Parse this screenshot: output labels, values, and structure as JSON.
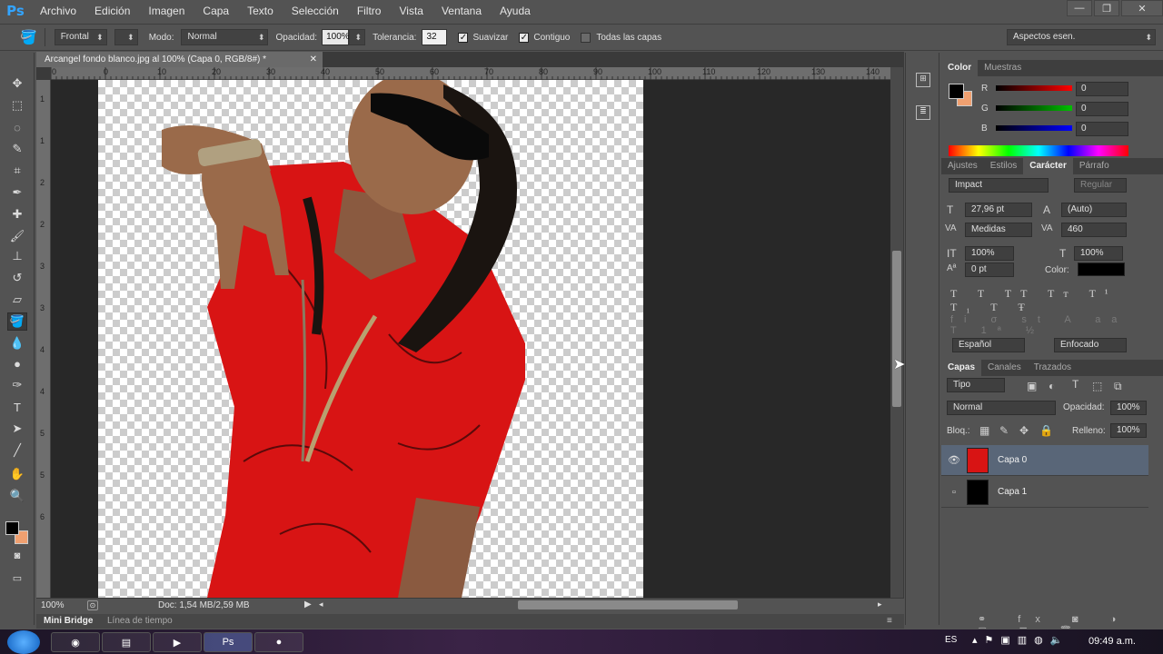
{
  "app": {
    "logo": "Ps",
    "title_controls": [
      "—",
      "❐",
      "✕"
    ]
  },
  "menu": [
    "Archivo",
    "Edición",
    "Imagen",
    "Capa",
    "Texto",
    "Selección",
    "Filtro",
    "Vista",
    "Ventana",
    "Ayuda"
  ],
  "options": {
    "fill_source": "Frontal",
    "mode_label": "Modo:",
    "mode_value": "Normal",
    "opacity_label": "Opacidad:",
    "opacity_value": "100%",
    "tolerance_label": "Tolerancia:",
    "tolerance_value": "32",
    "antialias_label": "Suavizar",
    "contiguous_label": "Contiguo",
    "all_layers_label": "Todas las capas",
    "workspace": "Aspectos esen."
  },
  "document": {
    "tab_title": "Arcangel fondo blanco.jpg al 100% (Capa 0, RGB/8#) *",
    "ruler_h": [
      "0",
      "0",
      "10",
      "20",
      "30",
      "40",
      "50",
      "60",
      "70",
      "80",
      "90",
      "100",
      "110",
      "120",
      "130",
      "140"
    ],
    "ruler_v": [
      "1",
      "1",
      "2",
      "2",
      "3",
      "3",
      "4",
      "4",
      "5",
      "5",
      "6"
    ],
    "zoom": "100%",
    "doc_size": "Doc: 1,54 MB/2,59 MB"
  },
  "bottom_tabs": [
    "Mini Bridge",
    "Línea de tiempo"
  ],
  "color_panel": {
    "tabs": [
      "Color",
      "Muestras"
    ],
    "fg_color": "#000000",
    "bg_color": "#f0a070",
    "r_label": "R",
    "r_value": "0",
    "g_label": "G",
    "g_value": "0",
    "b_label": "B",
    "b_value": "0"
  },
  "character_panel": {
    "tabs": [
      "Ajustes",
      "Estilos",
      "Carácter",
      "Párrafo"
    ],
    "font_family": "Impact",
    "font_style": "Regular",
    "font_size": "27,96 pt",
    "leading": "(Auto)",
    "kerning": "Medidas",
    "tracking": "460",
    "vscale": "100%",
    "hscale": "100%",
    "baseline": "0 pt",
    "color_label": "Color:",
    "language": "Español",
    "antialias": "Enfocado"
  },
  "layers_panel": {
    "tabs": [
      "Capas",
      "Canales",
      "Trazados"
    ],
    "filter_kind": "Tipo",
    "blend_mode": "Normal",
    "opacity_label": "Opacidad:",
    "opacity_value": "100%",
    "lock_label": "Bloq.:",
    "fill_label": "Relleno:",
    "fill_value": "100%",
    "layers": [
      {
        "name": "Capa 0",
        "visible": true,
        "selected": true
      },
      {
        "name": "Capa 1",
        "visible": false,
        "selected": false
      }
    ]
  },
  "taskbar": {
    "lang": "ES",
    "clock": "09:49 a.m.",
    "ps_label": "Ps"
  }
}
